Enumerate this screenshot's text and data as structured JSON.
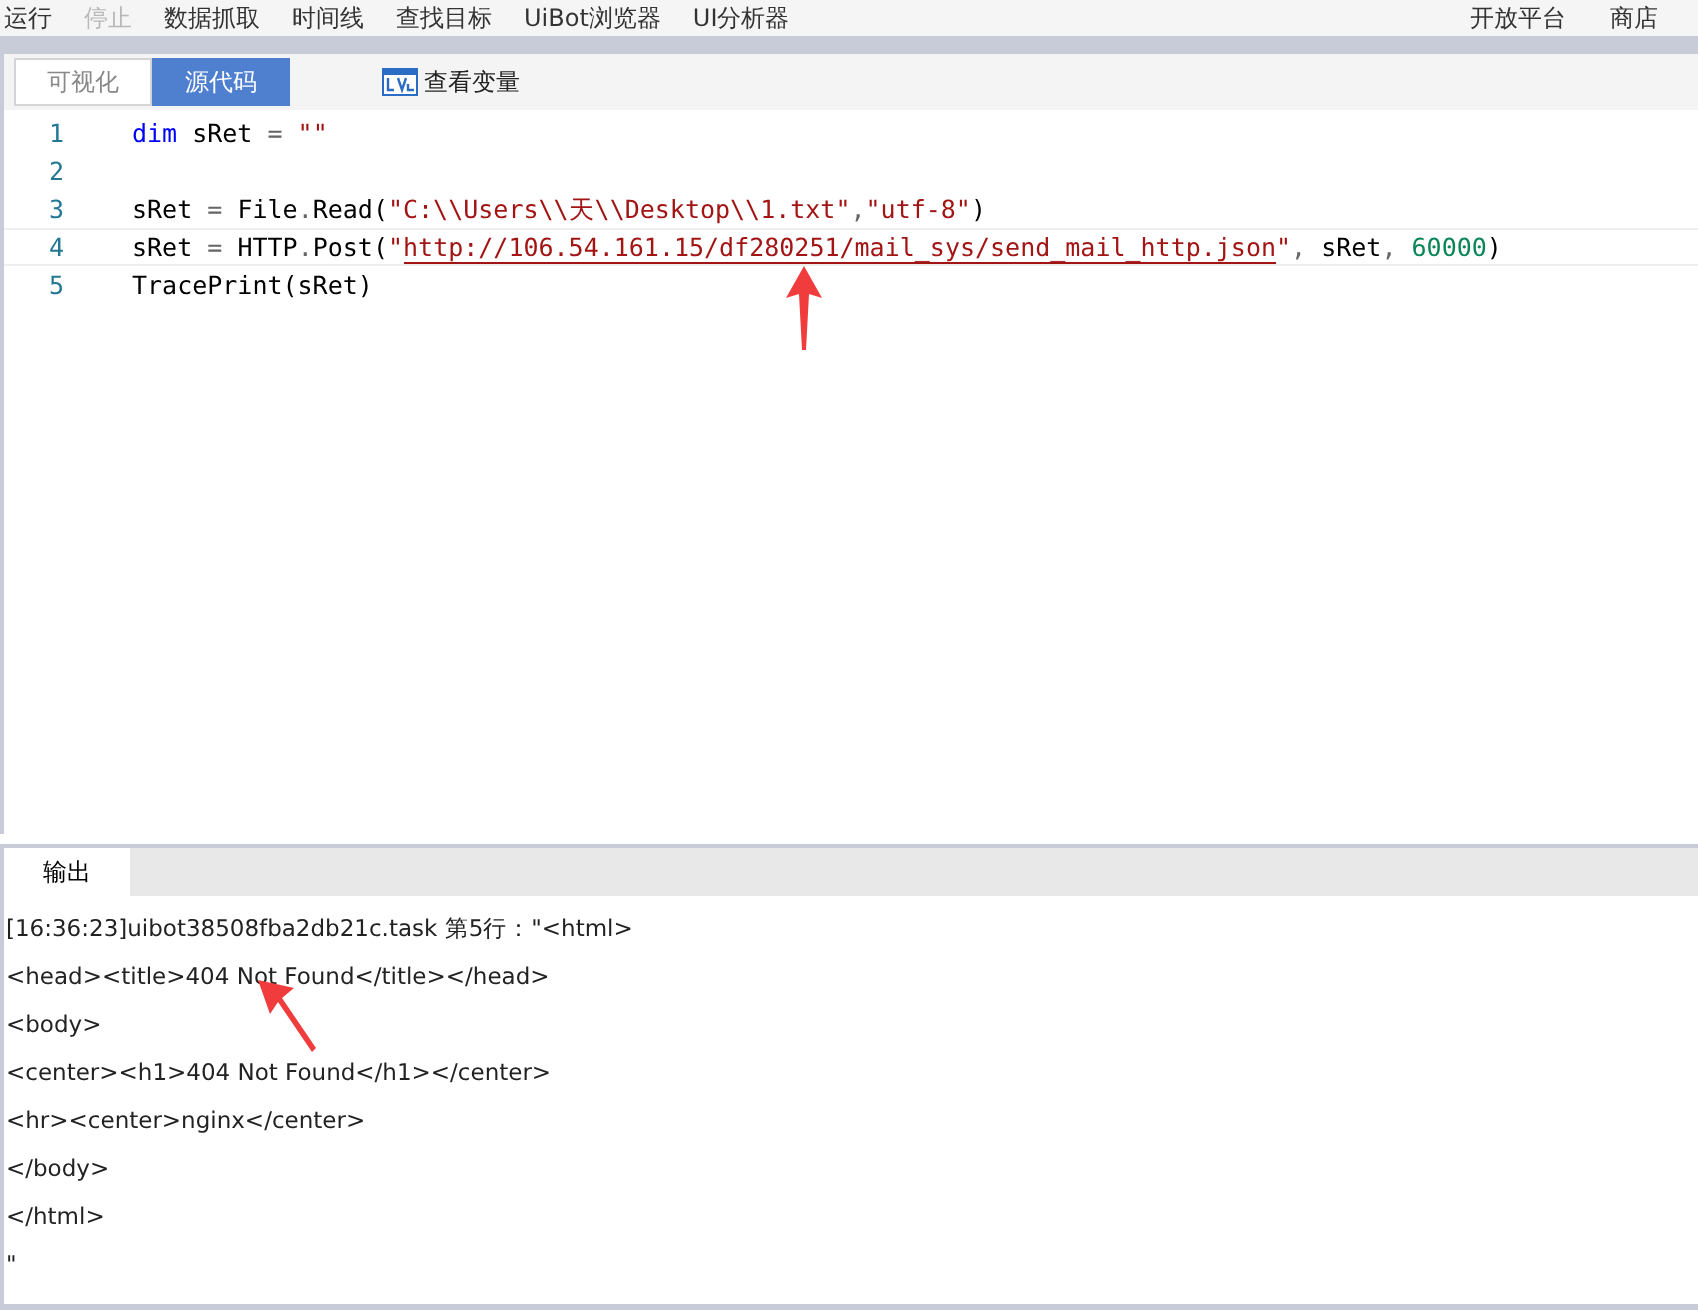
{
  "menu": [
    {
      "label": "运行",
      "disabled": false
    },
    {
      "label": "停止",
      "disabled": true
    },
    {
      "label": "数据抓取",
      "disabled": false
    },
    {
      "label": "时间线",
      "disabled": false
    },
    {
      "label": "查找目标",
      "disabled": false
    },
    {
      "label": "UiBot浏览器",
      "disabled": false
    },
    {
      "label": "UI分析器",
      "disabled": false
    }
  ],
  "menu_right": [
    "开放平台",
    "商店"
  ],
  "view_tabs": [
    {
      "label": "可视化",
      "selected": false
    },
    {
      "label": "源代码",
      "selected": true
    }
  ],
  "view_variables": "查看变量",
  "code_lines": [
    {
      "number": "1",
      "tokens": [
        {
          "kind": "keyword",
          "text": "dim"
        },
        {
          "kind": "plain",
          "text": " sRet "
        },
        {
          "kind": "punct",
          "text": "="
        },
        {
          "kind": "string",
          "text": " \"\""
        }
      ]
    },
    {
      "number": "2"
    },
    {
      "number": "3",
      "tokens": [
        {
          "kind": "plain",
          "text": "sRet "
        },
        {
          "kind": "punct",
          "text": "="
        },
        {
          "kind": "plain",
          "text": " File"
        },
        {
          "kind": "punct",
          "text": "."
        },
        {
          "kind": "plain",
          "text": "Read("
        },
        {
          "kind": "string",
          "text": "\"C:\\\\Users\\\\天\\\\Desktop\\\\1.txt\""
        },
        {
          "kind": "punct",
          "text": ","
        },
        {
          "kind": "string",
          "text": "\"utf-8\""
        },
        {
          "kind": "plain",
          "text": ")"
        }
      ]
    },
    {
      "number": "4",
      "tokens": [
        {
          "kind": "plain",
          "text": "sRet "
        },
        {
          "kind": "punct",
          "text": "="
        },
        {
          "kind": "plain",
          "text": " HTTP"
        },
        {
          "kind": "punct",
          "text": "."
        },
        {
          "kind": "plain",
          "text": "Post("
        },
        {
          "kind": "string",
          "text": "\""
        },
        {
          "kind": "url",
          "text": "http://106.54.161.15/df280251/mail_sys/send_mail_http.json"
        },
        {
          "kind": "string",
          "text": "\""
        },
        {
          "kind": "punct",
          "text": ","
        },
        {
          "kind": "plain",
          "text": " sRet"
        },
        {
          "kind": "punct",
          "text": ","
        },
        {
          "kind": "number",
          "text": " 60000"
        },
        {
          "kind": "plain",
          "text": ")"
        }
      ]
    },
    {
      "number": "5",
      "tokens": [
        {
          "kind": "plain",
          "text": "TracePrint(sRet)"
        }
      ]
    }
  ],
  "output_tab": "输出",
  "output_lines": [
    "[16:36:23]uibot38508fba2db21c.task 第5行：\"<html>",
    "<head><title>404 Not Found</title></head>",
    "<body>",
    "<center><h1>404 Not Found</h1></center>",
    "<hr><center>nginx</center>",
    "</body>",
    "</html>",
    "\""
  ]
}
